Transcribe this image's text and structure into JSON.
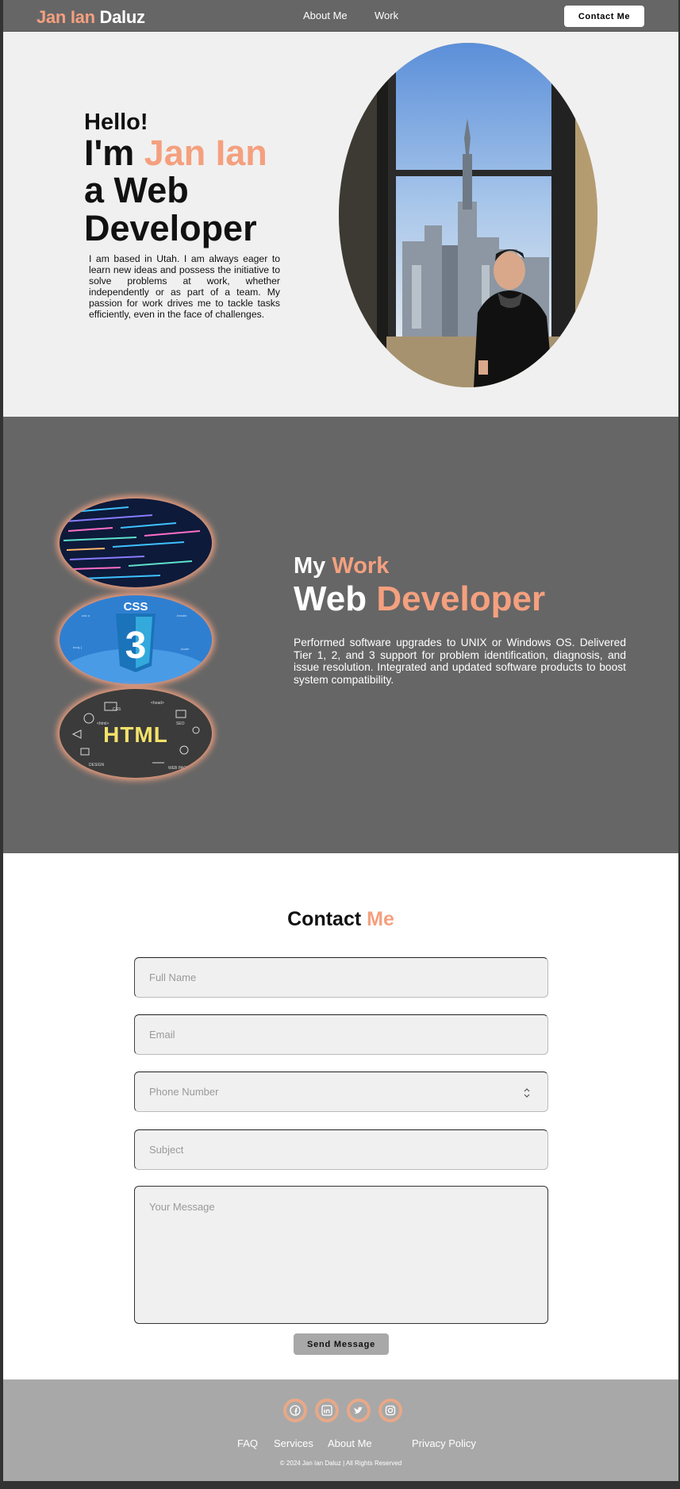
{
  "navbar": {
    "logo_first": "Jan Ian",
    "logo_last": "Daluz",
    "links": [
      "About Me",
      "Work"
    ],
    "contact_button": "Contact Me"
  },
  "hero": {
    "greeting": "Hello!",
    "intro_prefix": "I'm",
    "name": "Jan Ian",
    "role": "a Web Developer",
    "bio": "I am based in Utah. I am always eager to learn new ideas and possess the initiative to solve problems at work, whether independently or as part of a team. My passion for work drives me to tackle tasks efficiently, even in the face of challenges."
  },
  "work": {
    "heading_prefix": "My",
    "heading_highlight": "Work",
    "title_prefix": "Web",
    "title_highlight": "Developer",
    "description": "Performed software upgrades to UNIX or Windows OS. Delivered Tier 1, 2, and 3 support for problem identification, diagnosis, and issue resolution. Integrated and updated software products to boost system compatibility.",
    "thumbnails": [
      {
        "icon": "code-screen-image"
      },
      {
        "icon": "css3-logo-image",
        "label": "CSS"
      },
      {
        "icon": "html-doodle-image",
        "label": "HTML"
      }
    ]
  },
  "contact": {
    "title_prefix": "Contact",
    "title_highlight": "Me",
    "fields": {
      "full_name": "Full Name",
      "email": "Email",
      "phone": "Phone Number",
      "subject": "Subject",
      "message": "Your Message"
    },
    "send_button": "Send Message"
  },
  "footer": {
    "social_icons": [
      "facebook-icon",
      "linkedin-icon",
      "twitter-icon",
      "instagram-icon"
    ],
    "links": [
      "FAQ",
      "Services",
      "About Me",
      "Privacy Policy"
    ],
    "copyright": "© 2024 Jan Ian Daluz | All Rights Reserved"
  },
  "colors": {
    "accent": "#f4a07f",
    "nav_bg": "#666666",
    "footer_bg": "#a8a8a8"
  }
}
